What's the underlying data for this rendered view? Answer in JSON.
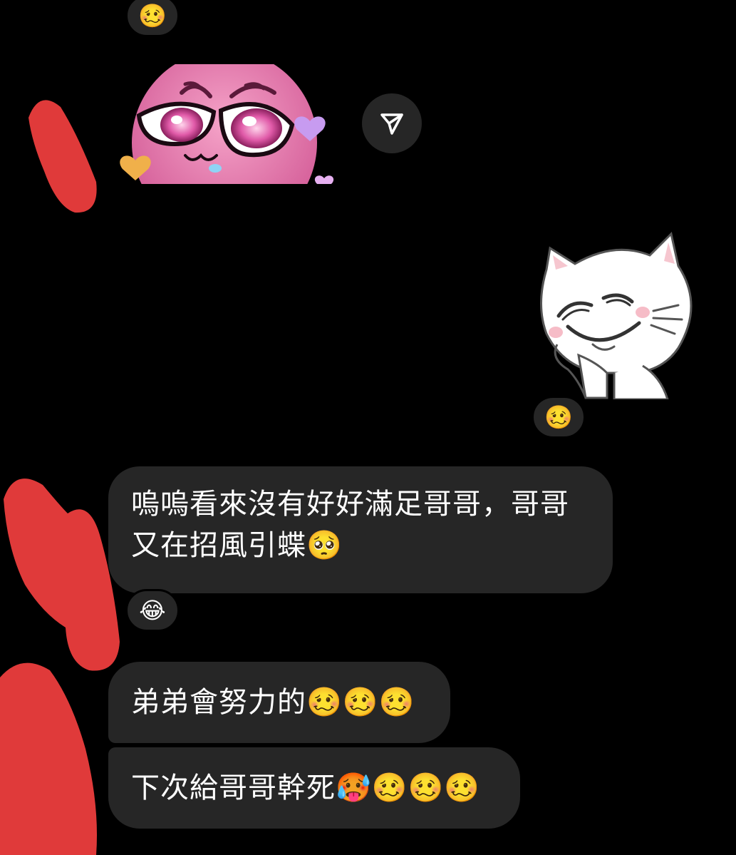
{
  "messages": [
    {
      "id": "received-1",
      "line1": "嗚嗚看來沒有好好滿足哥哥，哥哥",
      "line2": "又在招風引蝶🥺"
    },
    {
      "id": "received-2",
      "text": "弟弟會努力的🥴🥴🥴"
    },
    {
      "id": "received-3",
      "text": "下次給哥哥幹死🥵🥴🥴🥴"
    }
  ],
  "reactions": {
    "top_sticker": "🥴",
    "cat_sticker": "🥴",
    "message_1": "😂"
  },
  "stickers": {
    "received": "pink-face-sticker",
    "sent": "white-cat-sticker"
  },
  "icons": {
    "share": "share-icon"
  },
  "colors": {
    "background": "#000000",
    "bubble": "#262626",
    "text": "#ffffff",
    "redaction": "#e03a3a"
  }
}
